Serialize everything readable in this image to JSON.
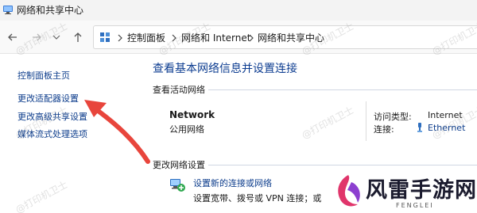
{
  "window": {
    "title": "网络和共享中心"
  },
  "address_bar": {
    "breadcrumbs": [
      "控制面板",
      "网络和 Internet",
      "网络和共享中心"
    ]
  },
  "sidebar": {
    "items": [
      {
        "label": "控制面板主页"
      },
      {
        "label": "更改适配器设置"
      },
      {
        "label": "更改高级共享设置"
      },
      {
        "label": "媒体流式处理选项"
      }
    ]
  },
  "main": {
    "title": "查看基本网络信息并设置连接",
    "active_networks_label": "查看活动网络",
    "network": {
      "name": "Network",
      "type": "公用网络",
      "access_type_label": "访问类型:",
      "access_type_value": "Internet",
      "connections_label": "连接:",
      "connections_value": "Ethernet"
    },
    "change_settings_label": "更改网络设置",
    "new_connection": {
      "link": "设置新的连接或网络",
      "description": "设置宽带、拨号或 VPN 连接；或"
    }
  },
  "watermark": {
    "text": "@打印机卫士"
  },
  "brand": {
    "name": "风雷手游网",
    "sub": "FENGLEI"
  },
  "colors": {
    "link": "#0d3d8c",
    "title": "#0c3c90",
    "arrow": "#e8453c"
  }
}
